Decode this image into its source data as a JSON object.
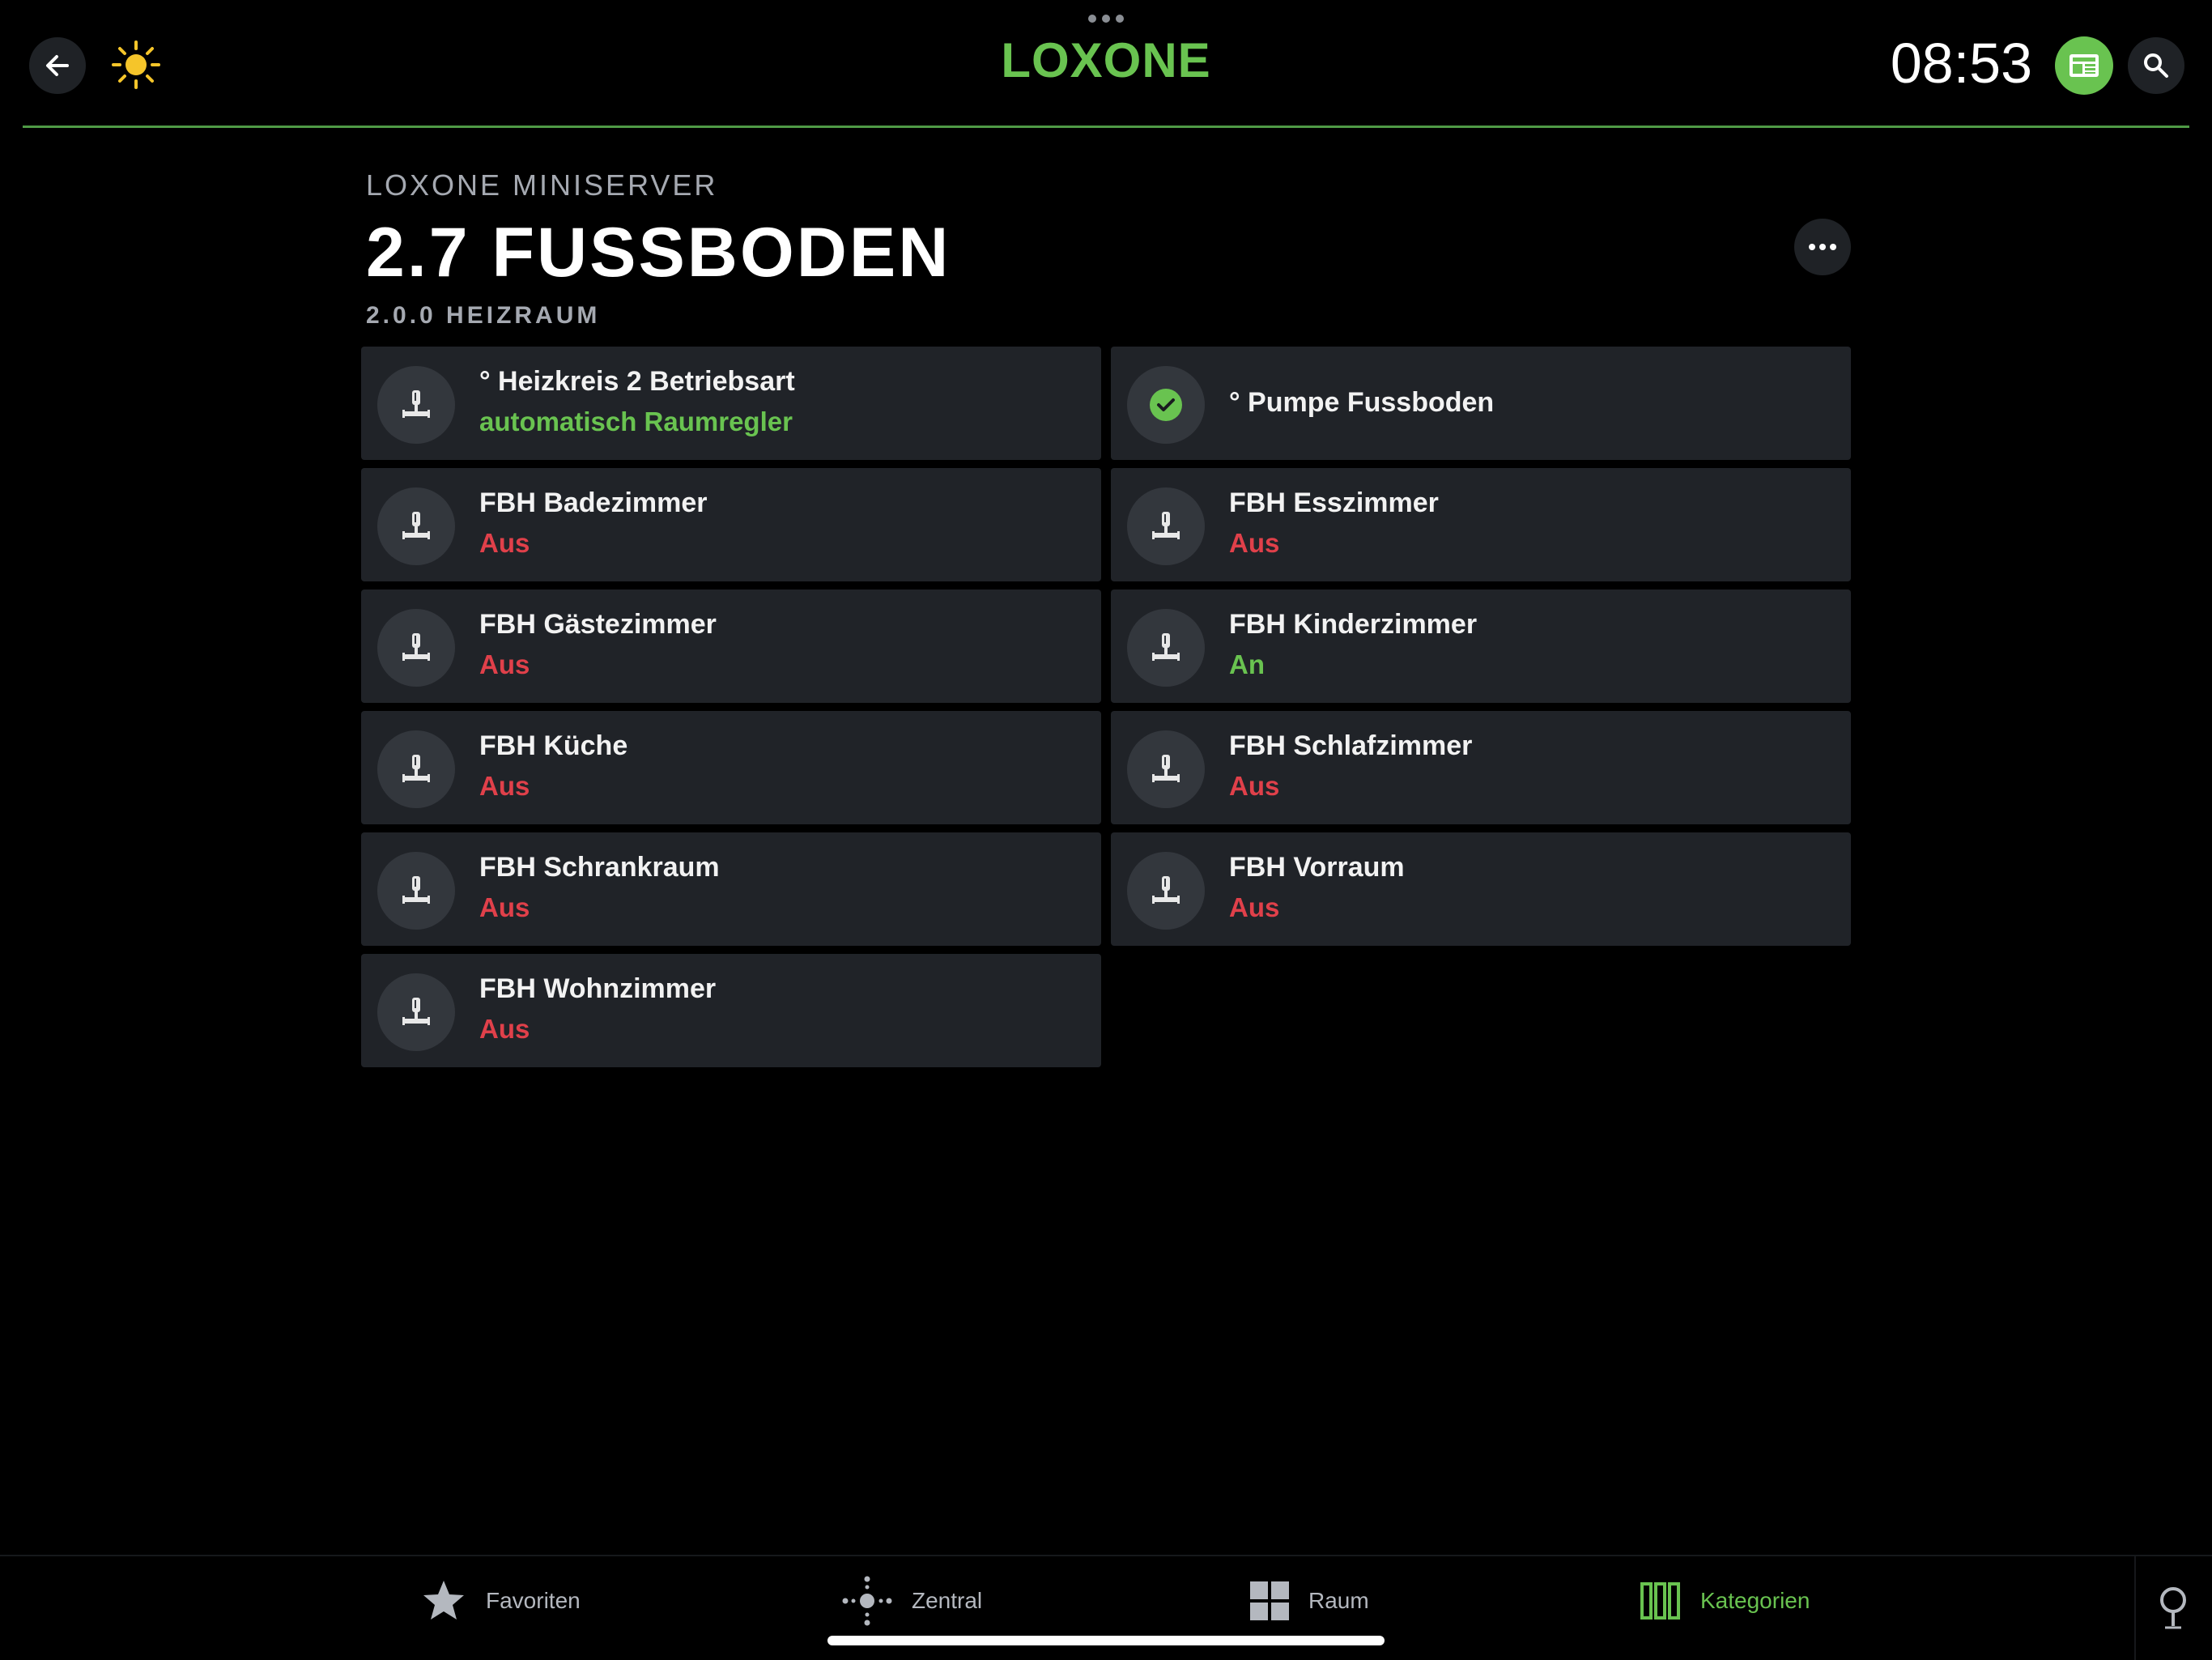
{
  "header": {
    "logo": "LOXONE",
    "time": "08:53"
  },
  "page": {
    "server": "LOXONE MINISERVER",
    "title": "2.7 FUSSBODEN",
    "room": "2.0.0 HEIZRAUM"
  },
  "colors": {
    "accent": "#69c350",
    "off": "#e0404a",
    "card": "#202328",
    "sun": "#f5c52a"
  },
  "cards": [
    {
      "name": "° Heizkreis 2 Betriebsart",
      "status": "automatisch Raumregler",
      "state": "on",
      "icon": "valve-icon"
    },
    {
      "name": "° Pumpe Fussboden",
      "status": "",
      "state": "on",
      "icon": "check-circle-icon"
    },
    {
      "name": "FBH Badezimmer",
      "status": "Aus",
      "state": "off",
      "icon": "valve-icon"
    },
    {
      "name": "FBH Esszimmer",
      "status": "Aus",
      "state": "off",
      "icon": "valve-icon"
    },
    {
      "name": "FBH Gästezimmer",
      "status": "Aus",
      "state": "off",
      "icon": "valve-icon"
    },
    {
      "name": "FBH Kinderzimmer",
      "status": "An",
      "state": "on",
      "icon": "valve-icon"
    },
    {
      "name": "FBH Küche",
      "status": "Aus",
      "state": "off",
      "icon": "valve-icon"
    },
    {
      "name": "FBH Schlafzimmer",
      "status": "Aus",
      "state": "off",
      "icon": "valve-icon"
    },
    {
      "name": "FBH Schrankraum",
      "status": "Aus",
      "state": "off",
      "icon": "valve-icon"
    },
    {
      "name": "FBH Vorraum",
      "status": "Aus",
      "state": "off",
      "icon": "valve-icon"
    },
    {
      "name": "FBH Wohnzimmer",
      "status": "Aus",
      "state": "off",
      "icon": "valve-icon"
    }
  ],
  "tabs": [
    {
      "label": "Favoriten",
      "icon": "star-icon",
      "active": false
    },
    {
      "label": "Zentral",
      "icon": "central-icon",
      "active": false
    },
    {
      "label": "Raum",
      "icon": "rooms-grid-icon",
      "active": false
    },
    {
      "label": "Kategorien",
      "icon": "categories-icon",
      "active": true
    }
  ]
}
